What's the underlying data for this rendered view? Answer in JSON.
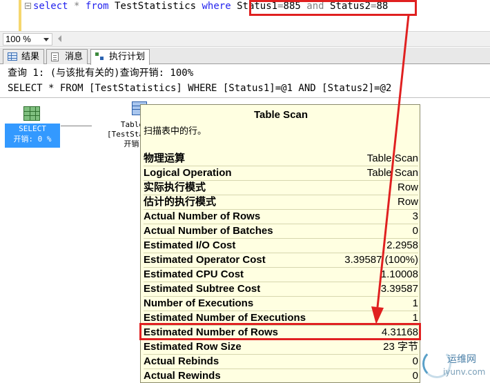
{
  "editor": {
    "select_kw": "select",
    "star": "*",
    "from_kw": "from",
    "table": "TestStatistics",
    "where_kw": "where",
    "col1": "Status1",
    "eq1": "=",
    "val1": "885",
    "and_kw": "and",
    "col2": "Status2",
    "eq2": "=",
    "val2": "88"
  },
  "zoom": {
    "value": "100 %"
  },
  "tabs": [
    {
      "label": "结果",
      "icon": "grid-icon"
    },
    {
      "label": "消息",
      "icon": "message-icon"
    },
    {
      "label": "执行计划",
      "icon": "execution-plan-icon",
      "active": true
    }
  ],
  "plan_header": {
    "line1": "查询 1: (与该批有关的)查询开销: 100%",
    "line2": "SELECT * FROM [TestStatistics] WHERE [Status1]=@1 AND [Status2]=@2"
  },
  "select_node": {
    "label": "SELECT",
    "cost": "开销: 0 %"
  },
  "table_node": {
    "line1": "Table",
    "line2": "[TestSta",
    "line3": "开销:"
  },
  "tooltip": {
    "title": "Table Scan",
    "description": "扫描表中的行。",
    "rows": [
      {
        "key": "物理运算",
        "value": "Table Scan"
      },
      {
        "key": "Logical Operation",
        "value": "Table Scan"
      },
      {
        "key": "实际执行模式",
        "value": "Row"
      },
      {
        "key": "估计的执行模式",
        "value": "Row"
      },
      {
        "key": "Actual Number of Rows",
        "value": "3"
      },
      {
        "key": "Actual Number of Batches",
        "value": "0"
      },
      {
        "key": "Estimated I/O Cost",
        "value": "2.2958"
      },
      {
        "key": "Estimated Operator Cost",
        "value": "3.39587 (100%)"
      },
      {
        "key": "Estimated CPU Cost",
        "value": "1.10008"
      },
      {
        "key": "Estimated Subtree Cost",
        "value": "3.39587"
      },
      {
        "key": "Number of Executions",
        "value": "1"
      },
      {
        "key": "Estimated Number of Executions",
        "value": "1"
      },
      {
        "key": "Estimated Number of Rows",
        "value": "4.31168"
      },
      {
        "key": "Estimated Row Size",
        "value": "23 字节"
      },
      {
        "key": "Actual Rebinds",
        "value": "0"
      },
      {
        "key": "Actual Rewinds",
        "value": "0"
      }
    ]
  },
  "annotation": {
    "color": "#e02020"
  },
  "watermark": {
    "cn": "运维网",
    "en": "iyunv.com"
  }
}
